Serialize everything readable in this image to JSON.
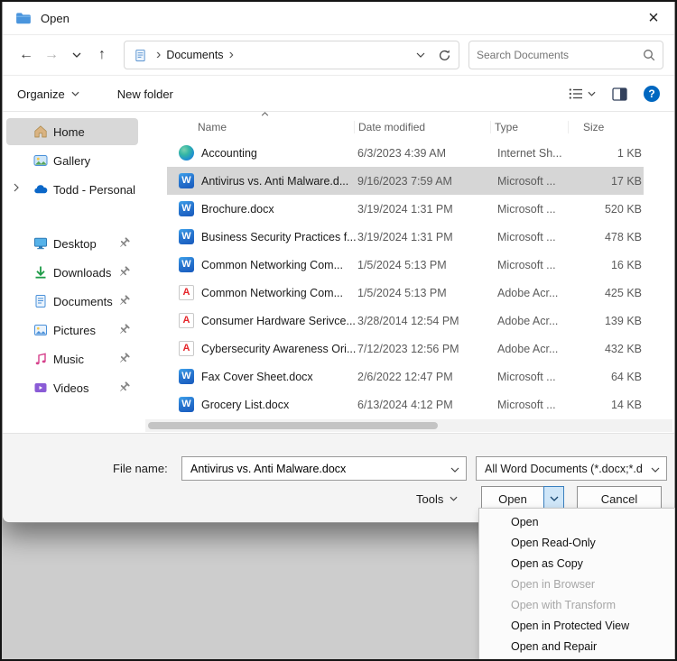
{
  "window": {
    "title": "Open",
    "close": "×"
  },
  "nav": {
    "back": "←",
    "forward": "→",
    "up": "↑",
    "breadcrumb_item": "Documents",
    "crumb_sep": "›",
    "search_placeholder": "Search Documents"
  },
  "commandbar": {
    "organize": "Organize",
    "new_folder": "New folder",
    "help": "?"
  },
  "sidebar": {
    "items": [
      {
        "label": "Home"
      },
      {
        "label": "Gallery"
      },
      {
        "label": "Todd - Personal",
        "chevron": "›"
      }
    ],
    "pinned": [
      {
        "label": "Desktop"
      },
      {
        "label": "Downloads"
      },
      {
        "label": "Documents"
      },
      {
        "label": "Pictures"
      },
      {
        "label": "Music"
      },
      {
        "label": "Videos"
      }
    ]
  },
  "filelist": {
    "sort_indicator": "∧",
    "columns": {
      "name": "Name",
      "date": "Date modified",
      "type": "Type",
      "size": "Size"
    },
    "rows": [
      {
        "name": "Accounting",
        "date": "6/3/2023 4:39 AM",
        "type": "Internet Sh...",
        "size": "1 KB",
        "icon": "internet",
        "state": "normal"
      },
      {
        "name": "Antivirus vs. Anti Malware.d...",
        "date": "9/16/2023 7:59 AM",
        "type": "Microsoft ...",
        "size": "17 KB",
        "icon": "word",
        "state": "selected"
      },
      {
        "name": "Brochure.docx",
        "date": "3/19/2024 1:31 PM",
        "type": "Microsoft ...",
        "size": "520 KB",
        "icon": "word",
        "state": "normal"
      },
      {
        "name": "Business Security Practices f...",
        "date": "3/19/2024 1:31 PM",
        "type": "Microsoft ...",
        "size": "478 KB",
        "icon": "word",
        "state": "normal"
      },
      {
        "name": "Common Networking Com...",
        "date": "1/5/2024 5:13 PM",
        "type": "Microsoft ...",
        "size": "16 KB",
        "icon": "word",
        "state": "normal"
      },
      {
        "name": "Common Networking Com...",
        "date": "1/5/2024 5:13 PM",
        "type": "Adobe Acr...",
        "size": "425 KB",
        "icon": "pdf",
        "state": "normal"
      },
      {
        "name": "Consumer Hardware Serivce...",
        "date": "3/28/2014 12:54 PM",
        "type": "Adobe Acr...",
        "size": "139 KB",
        "icon": "pdf",
        "state": "normal"
      },
      {
        "name": "Cybersecurity Awareness Ori...",
        "date": "7/12/2023 12:56 PM",
        "type": "Adobe Acr...",
        "size": "432 KB",
        "icon": "pdf",
        "state": "normal"
      },
      {
        "name": "Fax Cover Sheet.docx",
        "date": "2/6/2022 12:47 PM",
        "type": "Microsoft ...",
        "size": "64 KB",
        "icon": "word",
        "state": "normal"
      },
      {
        "name": "Grocery List.docx",
        "date": "6/13/2024 4:12 PM",
        "type": "Microsoft ...",
        "size": "14 KB",
        "icon": "word",
        "state": "normal"
      }
    ]
  },
  "footer": {
    "file_name_label": "File name:",
    "file_name_value": "Antivirus vs. Anti Malware.docx",
    "file_type_value": "All Word Documents (*.docx;*.d",
    "tools": "Tools",
    "open": "Open",
    "cancel": "Cancel"
  },
  "open_menu": {
    "items": [
      {
        "label": "Open",
        "state": "enabled"
      },
      {
        "label": "Open Read-Only",
        "state": "enabled"
      },
      {
        "label": "Open as Copy",
        "state": "enabled"
      },
      {
        "label": "Open in Browser",
        "state": "disabled"
      },
      {
        "label": "Open with Transform",
        "state": "disabled"
      },
      {
        "label": "Open in Protected View",
        "state": "enabled"
      },
      {
        "label": "Open and Repair",
        "state": "enabled"
      }
    ]
  },
  "colors": {
    "accent": "#0067c0",
    "selection": "#d6d6d6"
  }
}
